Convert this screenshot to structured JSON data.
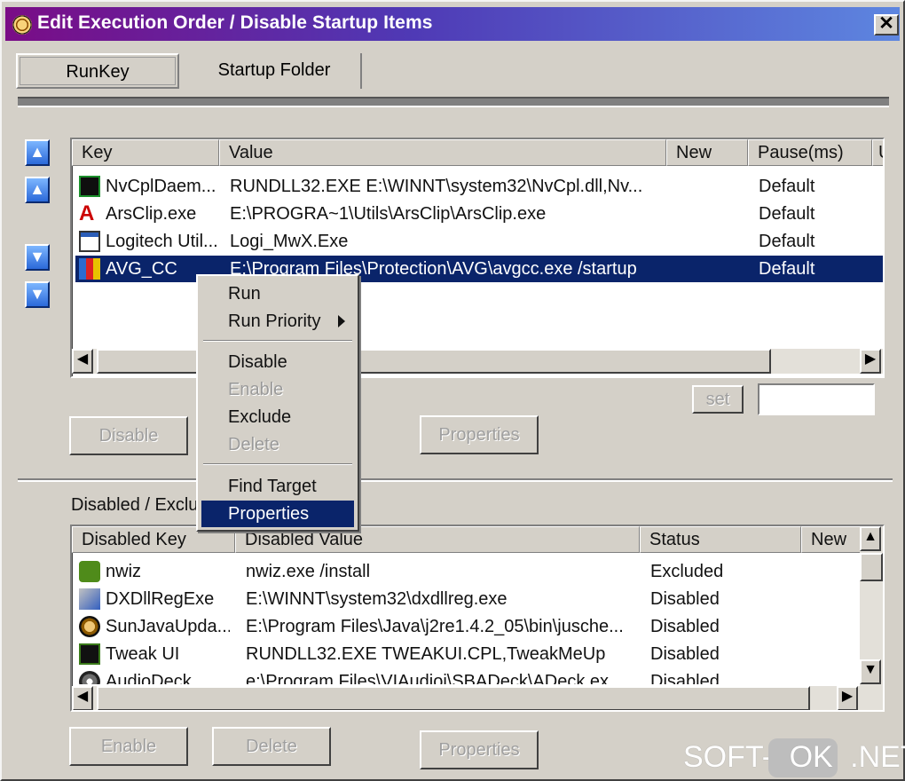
{
  "window": {
    "title": "Edit Execution Order / Disable Startup Items",
    "close_label": "✕"
  },
  "tabs": [
    {
      "label": "RunKey"
    },
    {
      "label": "Startup Folder"
    }
  ],
  "top_list": {
    "columns": [
      "Key",
      "Value",
      "New",
      "Pause(ms)",
      "U"
    ],
    "rows": [
      {
        "key": "NvCplDaem...",
        "value": "RUNDLL32.EXE E:\\WINNT\\system32\\NvCpl.dll,Nv...",
        "new": "",
        "pause": "Default",
        "icon": "nvidia-icon"
      },
      {
        "key": "ArsClip.exe",
        "value": "E:\\PROGRA~1\\Utils\\ArsClip\\ArsClip.exe",
        "new": "",
        "pause": "Default",
        "icon": "arsclip-icon"
      },
      {
        "key": "Logitech Util...",
        "value": "Logi_MwX.Exe",
        "new": "",
        "pause": "Default",
        "icon": "window-icon"
      },
      {
        "key": "AVG_CC",
        "value": "E:\\Program Files\\Protection\\AVG\\avgcc.exe /startup",
        "new": "",
        "pause": "Default",
        "icon": "avg-icon"
      }
    ]
  },
  "buttons": {
    "disable": "Disable",
    "properties": "Properties",
    "set": "set",
    "enable": "Enable",
    "delete": "Delete",
    "properties2": "Properties"
  },
  "context_menu": {
    "items": [
      "Run",
      "Run Priority",
      "Disable",
      "Enable",
      "Exclude",
      "Delete",
      "Find Target",
      "Properties"
    ]
  },
  "section": {
    "label": "Disabled / Exclu"
  },
  "bottom_list": {
    "columns": [
      "Disabled Key",
      "Disabled Value",
      "Status",
      "New"
    ],
    "rows": [
      {
        "key": "nwiz",
        "value": "nwiz.exe /install",
        "status": "Excluded",
        "icon": "nwiz-icon"
      },
      {
        "key": "DXDllRegExe",
        "value": "E:\\WINNT\\system32\\dxdllreg.exe",
        "status": "Disabled",
        "icon": "dx-icon"
      },
      {
        "key": "SunJavaUpda...",
        "value": "E:\\Program Files\\Java\\j2re1.4.2_05\\bin\\jusche...",
        "status": "Disabled",
        "icon": "java-icon"
      },
      {
        "key": "Tweak UI",
        "value": "RUNDLL32.EXE TWEAKUI.CPL,TweakMeUp",
        "status": "Disabled",
        "icon": "tweak-icon"
      },
      {
        "key": "AudioDeck",
        "value": "e:\\Program Files\\VIAudioi\\SBADeck\\ADeck.ex...",
        "status": "Disabled",
        "icon": "audio-icon"
      }
    ]
  },
  "watermark": {
    "text1": "SOFT-",
    "text2": "OK",
    ".text3": ".NET"
  }
}
